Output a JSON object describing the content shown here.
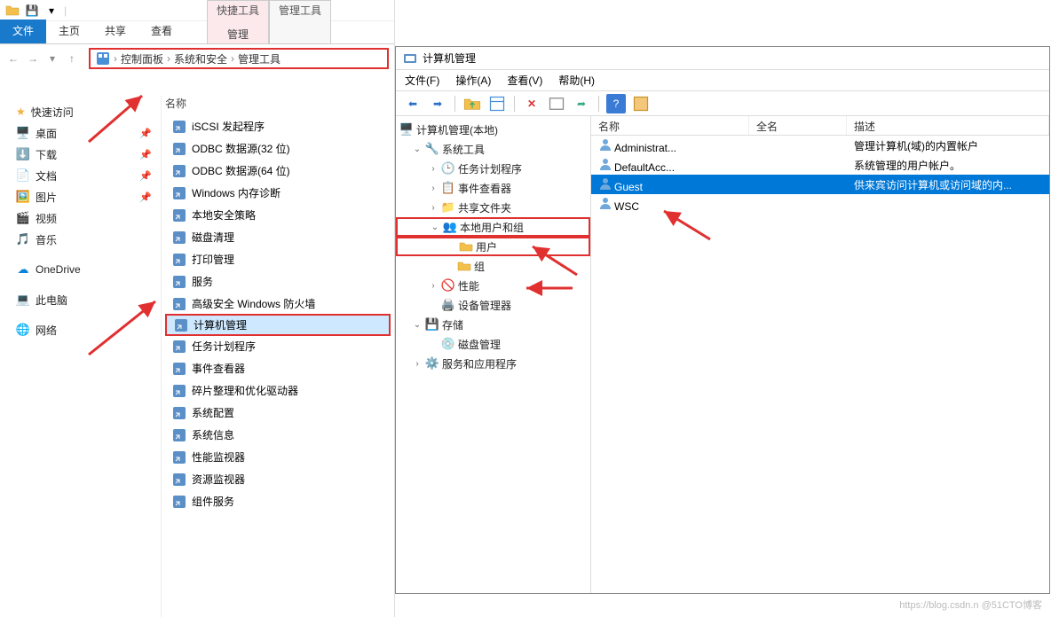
{
  "explorer": {
    "ribbon": {
      "tabs": [
        "文件",
        "主页",
        "共享",
        "查看"
      ],
      "quick_group_label": "快捷工具",
      "quick_group_btn": "管理",
      "mgmt_group_label": "管理工具"
    },
    "breadcrumb": [
      "控制面板",
      "系统和安全",
      "管理工具"
    ],
    "columns": {
      "name": "名称"
    },
    "nav": {
      "quick_access": "快速访问",
      "items": [
        {
          "label": "桌面",
          "pinned": true
        },
        {
          "label": "下载",
          "pinned": true
        },
        {
          "label": "文档",
          "pinned": true
        },
        {
          "label": "图片",
          "pinned": true
        },
        {
          "label": "视频",
          "pinned": false
        },
        {
          "label": "音乐",
          "pinned": false
        }
      ],
      "onedrive": "OneDrive",
      "this_pc": "此电脑",
      "network": "网络"
    },
    "files": [
      "iSCSI 发起程序",
      "ODBC 数据源(32 位)",
      "ODBC 数据源(64 位)",
      "Windows 内存诊断",
      "本地安全策略",
      "磁盘清理",
      "打印管理",
      "服务",
      "高级安全 Windows 防火墙",
      "计算机管理",
      "任务计划程序",
      "事件查看器",
      "碎片整理和优化驱动器",
      "系统配置",
      "系统信息",
      "性能监视器",
      "资源监视器",
      "组件服务"
    ],
    "selected_file_index": 9
  },
  "mmc": {
    "title": "计算机管理",
    "menu": [
      "文件(F)",
      "操作(A)",
      "查看(V)",
      "帮助(H)"
    ],
    "tree": {
      "root": "计算机管理(本地)",
      "system_tools": "系统工具",
      "task_scheduler": "任务计划程序",
      "event_viewer": "事件查看器",
      "shared_folders": "共享文件夹",
      "local_users_groups": "本地用户和组",
      "users": "用户",
      "groups": "组",
      "performance": "性能",
      "device_manager": "设备管理器",
      "storage": "存储",
      "disk_mgmt": "磁盘管理",
      "services_apps": "服务和应用程序"
    },
    "list": {
      "cols": {
        "name": "名称",
        "fullname": "全名",
        "desc": "描述"
      },
      "rows": [
        {
          "name": "Administrat...",
          "full": "",
          "desc": "管理计算机(域)的内置帐户"
        },
        {
          "name": "DefaultAcc...",
          "full": "",
          "desc": "系统管理的用户帐户。"
        },
        {
          "name": "Guest",
          "full": "",
          "desc": "供来宾访问计算机或访问域的内..."
        },
        {
          "name": "WSC",
          "full": "",
          "desc": ""
        }
      ],
      "selected_index": 2
    }
  },
  "watermark": "https://blog.csdn.n  @51CTO博客"
}
